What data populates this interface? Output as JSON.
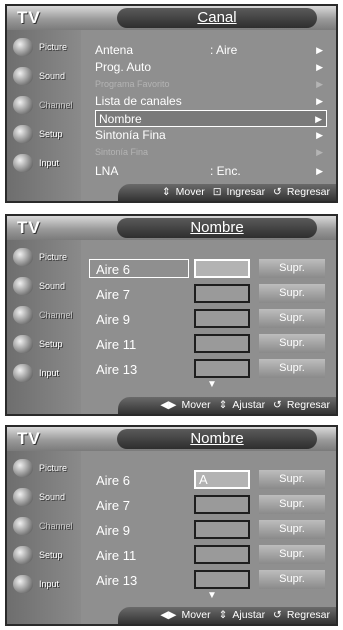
{
  "tv_label": "TV",
  "sidebar": [
    "Picture",
    "Sound",
    "Channel",
    "Setup",
    "Input"
  ],
  "screen1": {
    "title": "Canal",
    "menu": [
      {
        "label": "Antena",
        "value": ": Aire"
      },
      {
        "label": "Prog. Auto",
        "value": ""
      },
      {
        "label": "Programa Favorito",
        "value": ""
      },
      {
        "label": "Lista de canales",
        "value": ""
      },
      {
        "label": "Nombre",
        "value": ""
      },
      {
        "label": "Sintonía Fina",
        "value": ""
      },
      {
        "label": "Sintonía Fina",
        "value": ""
      },
      {
        "label": "LNA",
        "value": ": Enc."
      }
    ],
    "footer": {
      "move": "Mover",
      "enter": "Ingresar",
      "return": "Regresar"
    }
  },
  "screen2": {
    "title": "Nombre",
    "channels": [
      "Aire 6",
      "Aire 7",
      "Aire 9",
      "Aire 11",
      "Aire 13"
    ],
    "name_values": [
      "",
      "",
      "",
      "",
      ""
    ],
    "delete_label": "Supr.",
    "footer": {
      "move": "Mover",
      "adjust": "Ajustar",
      "return": "Regresar"
    }
  },
  "screen3": {
    "title": "Nombre",
    "channels": [
      "Aire 6",
      "Aire 7",
      "Aire 9",
      "Aire 11",
      "Aire 13"
    ],
    "name_values": [
      "A",
      "",
      "",
      "",
      ""
    ],
    "delete_label": "Supr.",
    "footer": {
      "move": "Mover",
      "adjust": "Ajustar",
      "return": "Regresar"
    }
  }
}
